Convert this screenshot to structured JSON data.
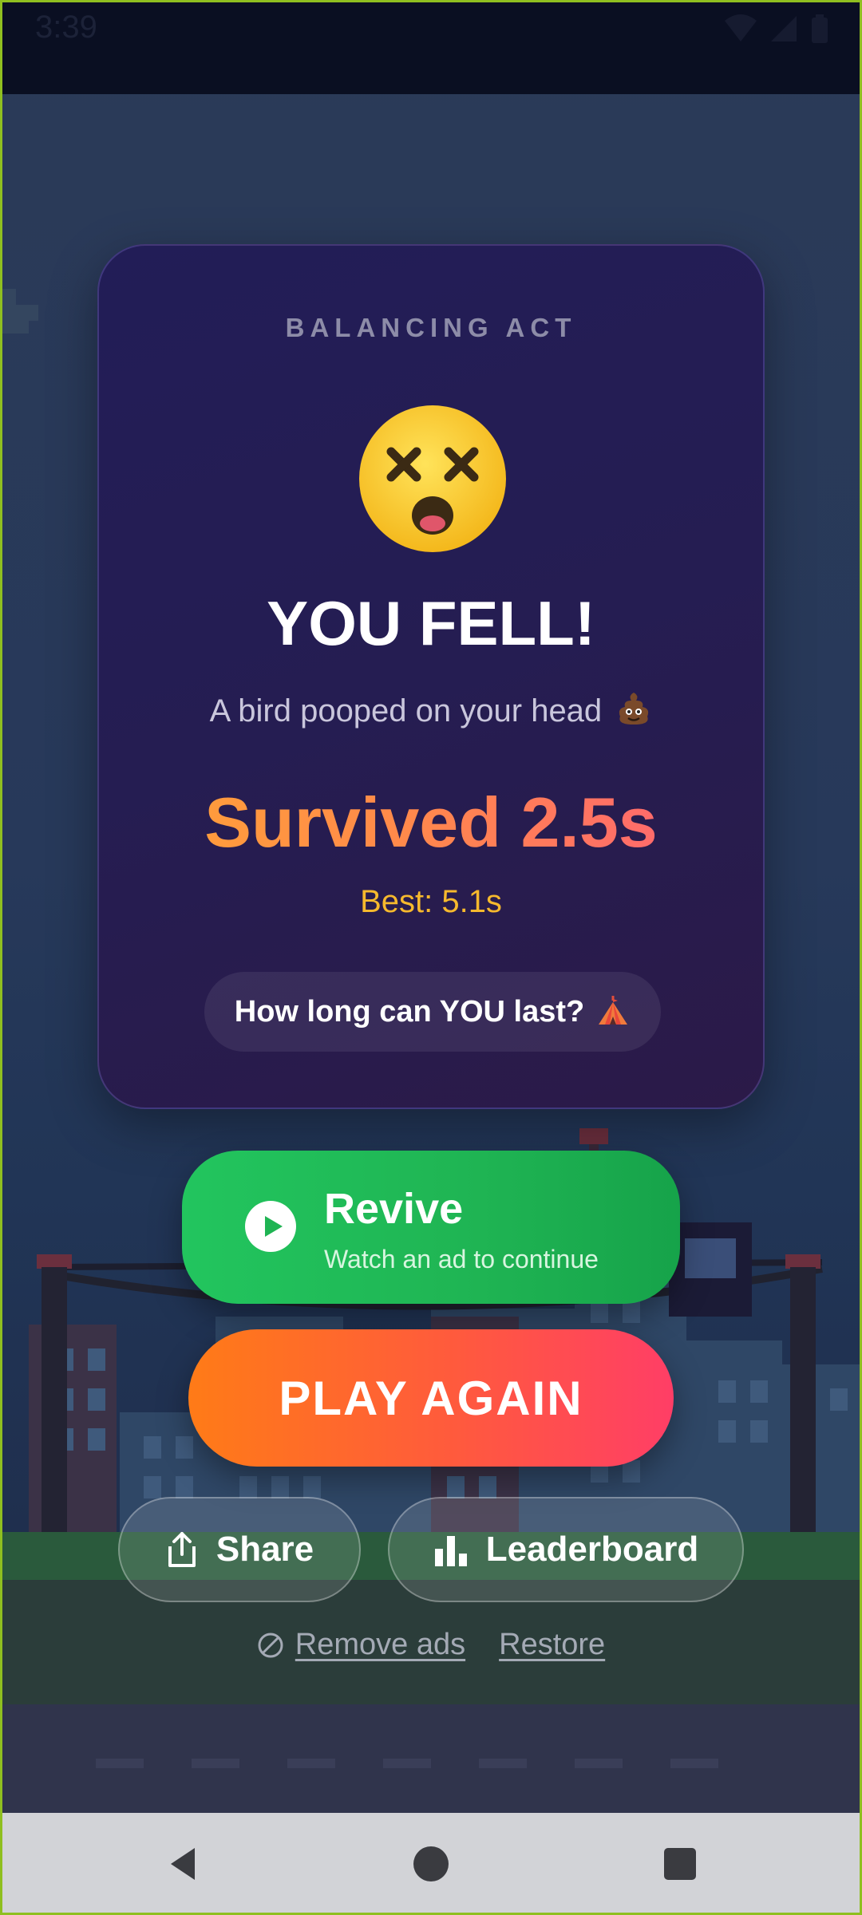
{
  "status_bar": {
    "time": "3:39"
  },
  "card": {
    "game_name": "BALANCING ACT",
    "face_icon": "dizzy-face-emoji",
    "title": "YOU FELL!",
    "cause": "A bird pooped on your head",
    "cause_icon": "pile-of-poo-emoji",
    "survived": "Survived 2.5s",
    "best": "Best: 5.1s",
    "challenge": "How long can YOU last?",
    "challenge_icon": "circus-tent-emoji"
  },
  "actions": {
    "revive_title": "Revive",
    "revive_subtitle": "Watch an ad to continue",
    "play_again": "PLAY AGAIN",
    "share": "Share",
    "leaderboard": "Leaderboard",
    "remove_ads": "Remove ads",
    "restore": "Restore"
  },
  "colors": {
    "revive": "#22c55e",
    "play_again_start": "#ff7b17",
    "play_again_end": "#ff3e66",
    "best": "#f6b92d",
    "card_bg": "#231d55"
  }
}
